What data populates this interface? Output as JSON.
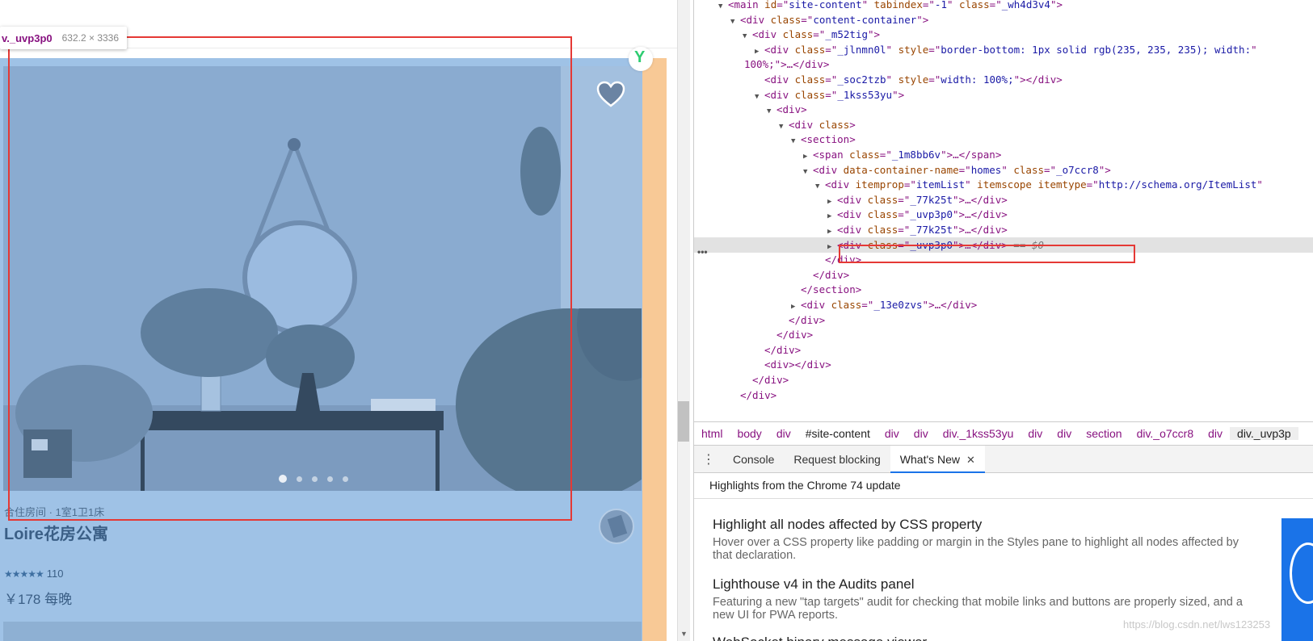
{
  "inspect_tooltip": {
    "tag": "v._uvp3p0",
    "size": "632.2 × 3336"
  },
  "listing": {
    "meta": "合住房间 · 1室1卫1床",
    "title": "Loire花房公寓",
    "stars": "★★★★★",
    "reviews": "110",
    "price": "￥178 每晚",
    "carousel_dots": 5
  },
  "elements_tree": [
    {
      "indent": 0,
      "tri": "▼",
      "tag": "main",
      "attrs": [
        [
          "id",
          "site-content"
        ],
        [
          "tabindex",
          "-1"
        ],
        [
          "class",
          "_wh4d3v4"
        ]
      ],
      "close": ">"
    },
    {
      "indent": 1,
      "tri": "▼",
      "tag": "div",
      "attrs": [
        [
          "class",
          "content-container"
        ]
      ],
      "close": ">"
    },
    {
      "indent": 2,
      "tri": "▼",
      "tag": "div",
      "attrs": [
        [
          "class",
          "_m52tig"
        ]
      ],
      "close": ">"
    },
    {
      "indent": 3,
      "tri": "▶",
      "tag": "div",
      "attrs": [
        [
          "class",
          "_jlnmn0l"
        ],
        [
          "style",
          "border-bottom: 1px solid rgb(235, 235, 235); width:"
        ]
      ],
      "close": ""
    },
    {
      "indent": 3,
      "tri": "",
      "raw": "100%;\">…</div>",
      "wrap": true
    },
    {
      "indent": 3,
      "tri": "",
      "tag": "div",
      "attrs": [
        [
          "class",
          "_soc2tzb"
        ],
        [
          "style",
          "width: 100%;"
        ]
      ],
      "close": "></div>"
    },
    {
      "indent": 3,
      "tri": "▼",
      "tag": "div",
      "attrs": [
        [
          "class",
          "_1kss53yu"
        ]
      ],
      "close": ">"
    },
    {
      "indent": 4,
      "tri": "▼",
      "tag": "div",
      "attrs": [],
      "close": ">"
    },
    {
      "indent": 5,
      "tri": "▼",
      "tag": "div",
      "attrs": [],
      "bare": "class",
      "close": ">"
    },
    {
      "indent": 6,
      "tri": "▼",
      "tag": "section",
      "attrs": [],
      "close": ">"
    },
    {
      "indent": 7,
      "tri": "▶",
      "tag": "span",
      "attrs": [
        [
          "class",
          "_1m8bb6v"
        ]
      ],
      "close": ">…</span>"
    },
    {
      "indent": 7,
      "tri": "▼",
      "tag": "div",
      "attrs": [
        [
          "data-container-name",
          "homes"
        ],
        [
          "class",
          "_o7ccr8"
        ]
      ],
      "close": ">"
    },
    {
      "indent": 8,
      "tri": "▼",
      "tag": "div",
      "attrs": [
        [
          "itemprop",
          "itemList"
        ]
      ],
      "bare": "itemscope",
      "extra": [
        [
          "itemtype",
          "http://schema.org/ItemList"
        ]
      ],
      "close": ""
    },
    {
      "indent": 9,
      "tri": "▶",
      "tag": "div",
      "attrs": [
        [
          "class",
          "_77k25t"
        ]
      ],
      "close": ">…</div>"
    },
    {
      "indent": 9,
      "tri": "▶",
      "tag": "div",
      "attrs": [
        [
          "class",
          "_uvp3p0"
        ]
      ],
      "close": ">…</div>"
    },
    {
      "indent": 9,
      "tri": "▶",
      "tag": "div",
      "attrs": [
        [
          "class",
          "_77k25t"
        ]
      ],
      "close": ">…</div>"
    },
    {
      "indent": 9,
      "tri": "▶",
      "tag": "div",
      "attrs": [
        [
          "class",
          "_uvp3p0"
        ]
      ],
      "close": ">…</div>",
      "selected": true,
      "suffix": " == $0"
    },
    {
      "indent": 8,
      "tri": "",
      "raw": "</div>"
    },
    {
      "indent": 7,
      "tri": "",
      "raw": "</div>"
    },
    {
      "indent": 6,
      "tri": "",
      "raw": "</section>"
    },
    {
      "indent": 6,
      "tri": "▶",
      "tag": "div",
      "attrs": [
        [
          "class",
          "_13e0zvs"
        ]
      ],
      "close": ">…</div>"
    },
    {
      "indent": 5,
      "tri": "",
      "raw": "</div>"
    },
    {
      "indent": 4,
      "tri": "",
      "raw": "</div>"
    },
    {
      "indent": 3,
      "tri": "",
      "raw": "</div>"
    },
    {
      "indent": 3,
      "tri": "",
      "raw": "<div></div>"
    },
    {
      "indent": 2,
      "tri": "",
      "raw": "</div>"
    },
    {
      "indent": 1,
      "tri": "",
      "raw": "</div>"
    }
  ],
  "breadcrumb": [
    "html",
    "body",
    "div",
    "#site-content",
    "div",
    "div",
    "div._1kss53yu",
    "div",
    "div",
    "section",
    "div._o7ccr8",
    "div",
    "div._uvp3p"
  ],
  "drawer": {
    "tabs": [
      "Console",
      "Request blocking",
      "What's New"
    ],
    "active_tab": "What's New",
    "close_glyph": "✕",
    "header": "Highlights from the Chrome 74 update",
    "items": [
      {
        "title": "Highlight all nodes affected by CSS property",
        "desc": "Hover over a CSS property like padding or margin in the Styles pane to highlight all nodes affected by that declaration."
      },
      {
        "title": "Lighthouse v4 in the Audits panel",
        "desc": "Featuring a new \"tap targets\" audit for checking that mobile links and buttons are properly sized, and a new UI for PWA reports."
      }
    ],
    "next_title": "WebSocket binary message viewer"
  },
  "watermark": "https://blog.csdn.net/lws123253",
  "icons": {
    "favorite": "heart-icon",
    "extension": "y-logo-icon",
    "menu": "kebab-icon",
    "close": "close-icon"
  },
  "colors": {
    "overlay": "#9fc2e6",
    "padding": "#f8c996",
    "highlight": "#e53935",
    "tab_active": "#1a73e8"
  }
}
